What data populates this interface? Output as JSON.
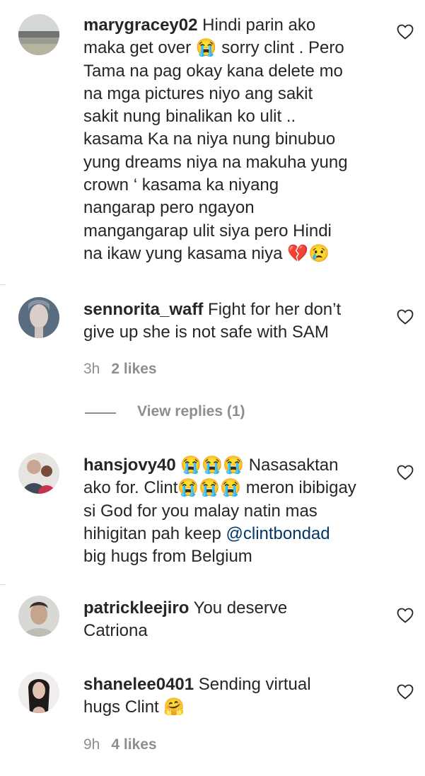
{
  "comments": [
    {
      "username": "marygracey02",
      "lines": [
        " Hindi parin ako",
        "maka get over 😭 sorry clint . Pero",
        "Tama na pag okay kana delete mo",
        "na mga pictures niyo ang sakit",
        "sakit nung binalikan ko ulit ..",
        "kasama Ka na niya nung binubuo",
        "yung dreams niya na makuha yung",
        "crown ‘ kasama ka niyang",
        "nangarap pero ngayon",
        "mangangarap ulit siya pero Hindi",
        "na ikaw yung kasama niya 💔😢"
      ],
      "heart_icon": "heart-outline-icon"
    },
    {
      "username": "sennorita_waff",
      "lines": [
        " Fight for her don’t",
        "give up she is not safe with SAM"
      ],
      "time": "3h",
      "likes": "2 likes",
      "view_replies": "View replies (1)",
      "heart_icon": "heart-outline-icon"
    },
    {
      "username": "hansjovy40",
      "lines_before_mention": [
        " 😭😭😭 Nasasaktan",
        "ako for. Clint😭😭😭 meron ibibigay",
        "si God for you malay natin mas",
        "hihigitan pah keep "
      ],
      "mention": "@clintbondad",
      "lines_after_mention": [
        "big hugs from Belgium"
      ],
      "heart_icon": "heart-outline-icon"
    },
    {
      "username": "patrickleejiro",
      "lines": [
        " You deserve",
        "Catriona"
      ],
      "heart_icon": "heart-outline-icon"
    },
    {
      "username": "shanelee0401",
      "lines": [
        " Sending virtual",
        "hugs Clint 🤗"
      ],
      "time": "9h",
      "likes": "4 likes",
      "heart_icon": "heart-outline-icon"
    }
  ],
  "colors": {
    "text": "#262626",
    "meta": "#8e8e8e",
    "mention": "#00376b",
    "divider": "#dbdbdb"
  }
}
